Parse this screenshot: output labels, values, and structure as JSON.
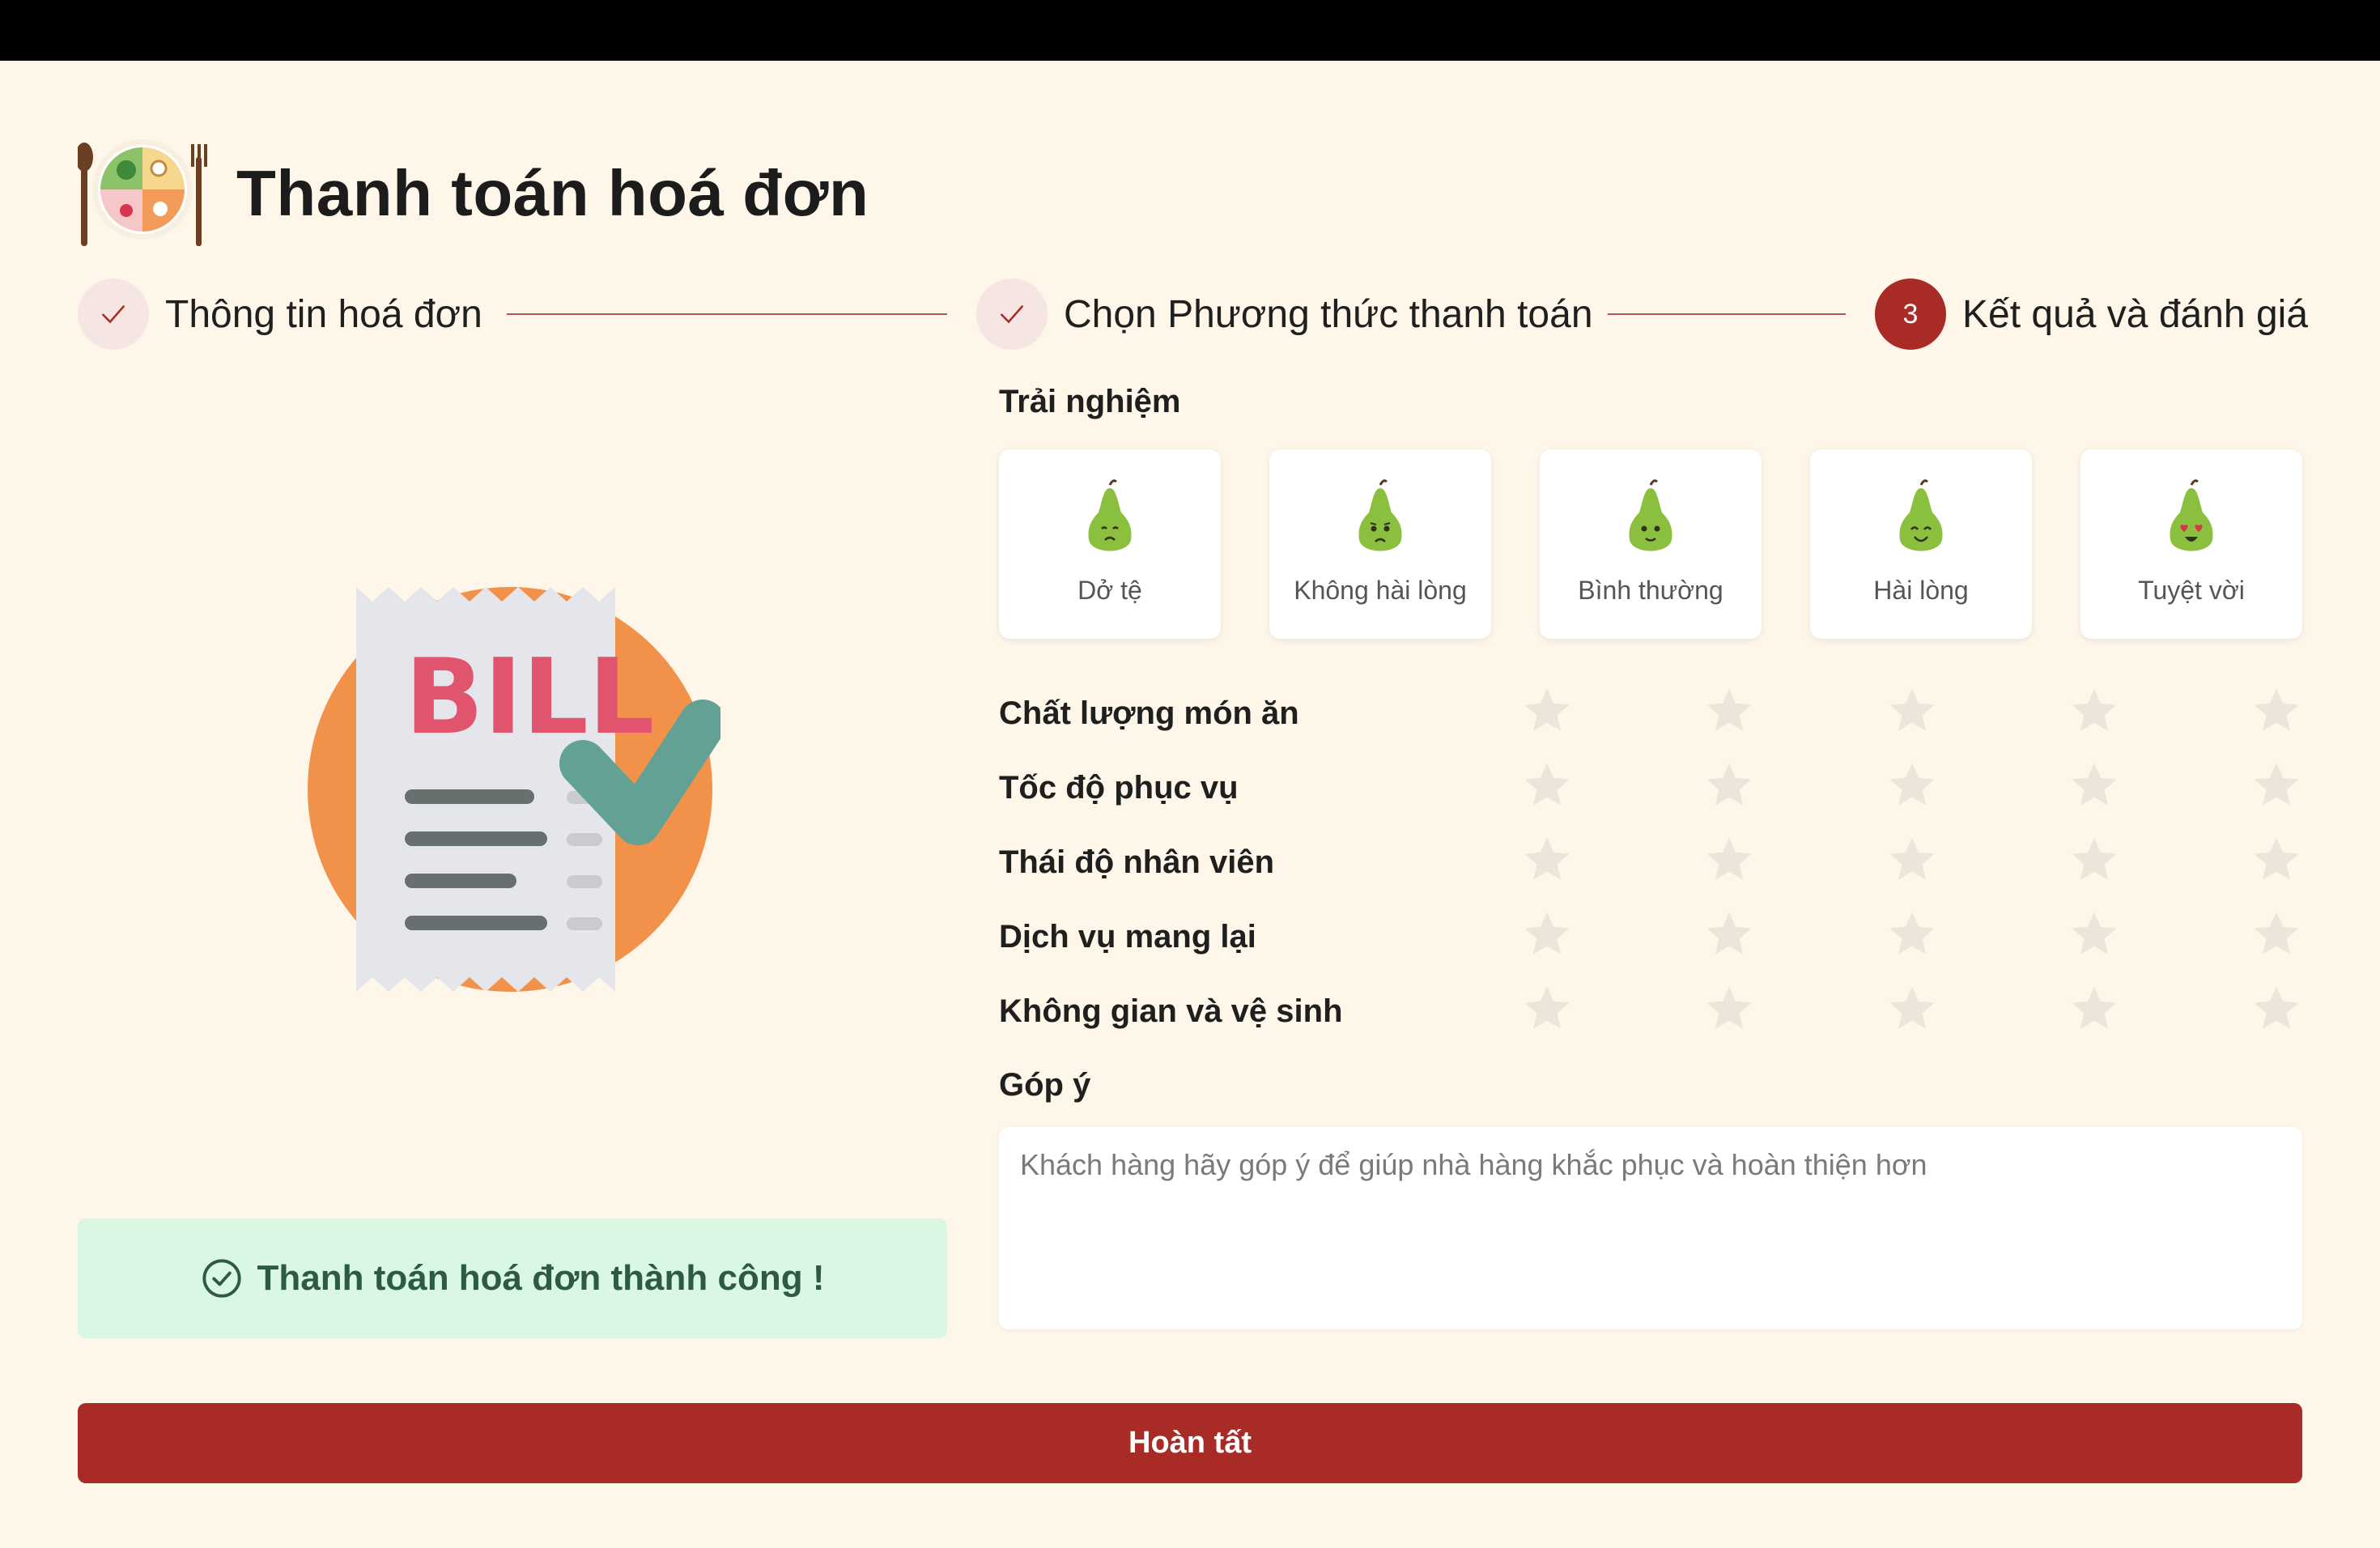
{
  "page": {
    "title": "Thanh toán hoá đơn",
    "logo_icon": "food-plate-logo-icon"
  },
  "stepper": {
    "steps": [
      {
        "label": "Thông tin hoá đơn",
        "status": "done",
        "icon": "check-icon"
      },
      {
        "label": "Chọn Phương thức thanh toán",
        "status": "done",
        "icon": "check-icon"
      },
      {
        "label": "Kết quả và đánh giá",
        "status": "active",
        "number": "3"
      }
    ],
    "accent_color": "#a82b25"
  },
  "bill": {
    "illustration_text": "BILL",
    "success_message": "Thanh toán hoá đơn thành công !",
    "success_icon": "check-circle-icon"
  },
  "experience": {
    "label": "Trải nghiệm",
    "options": [
      {
        "label": "Dở tệ",
        "icon": "pear-sad-icon"
      },
      {
        "label": "Không hài lòng",
        "icon": "pear-worried-icon"
      },
      {
        "label": "Bình thường",
        "icon": "pear-neutral-icon"
      },
      {
        "label": "Hài lòng",
        "icon": "pear-happy-icon"
      },
      {
        "label": "Tuyệt vời",
        "icon": "pear-love-icon"
      }
    ]
  },
  "ratings": {
    "max_stars": 5,
    "star_color": "#ece5d9",
    "items": [
      {
        "label": "Chất lượng món ăn",
        "value": 0
      },
      {
        "label": "Tốc độ phục vụ",
        "value": 0
      },
      {
        "label": "Thái độ nhân viên",
        "value": 0
      },
      {
        "label": "Dịch vụ mang lại",
        "value": 0
      },
      {
        "label": "Không gian và vệ sinh",
        "value": 0
      }
    ]
  },
  "feedback": {
    "label": "Góp ý",
    "placeholder": "Khách hàng hãy góp ý để giúp nhà hàng khắc phục và hoàn thiện hơn",
    "value": ""
  },
  "actions": {
    "finish_label": "Hoàn tất"
  }
}
